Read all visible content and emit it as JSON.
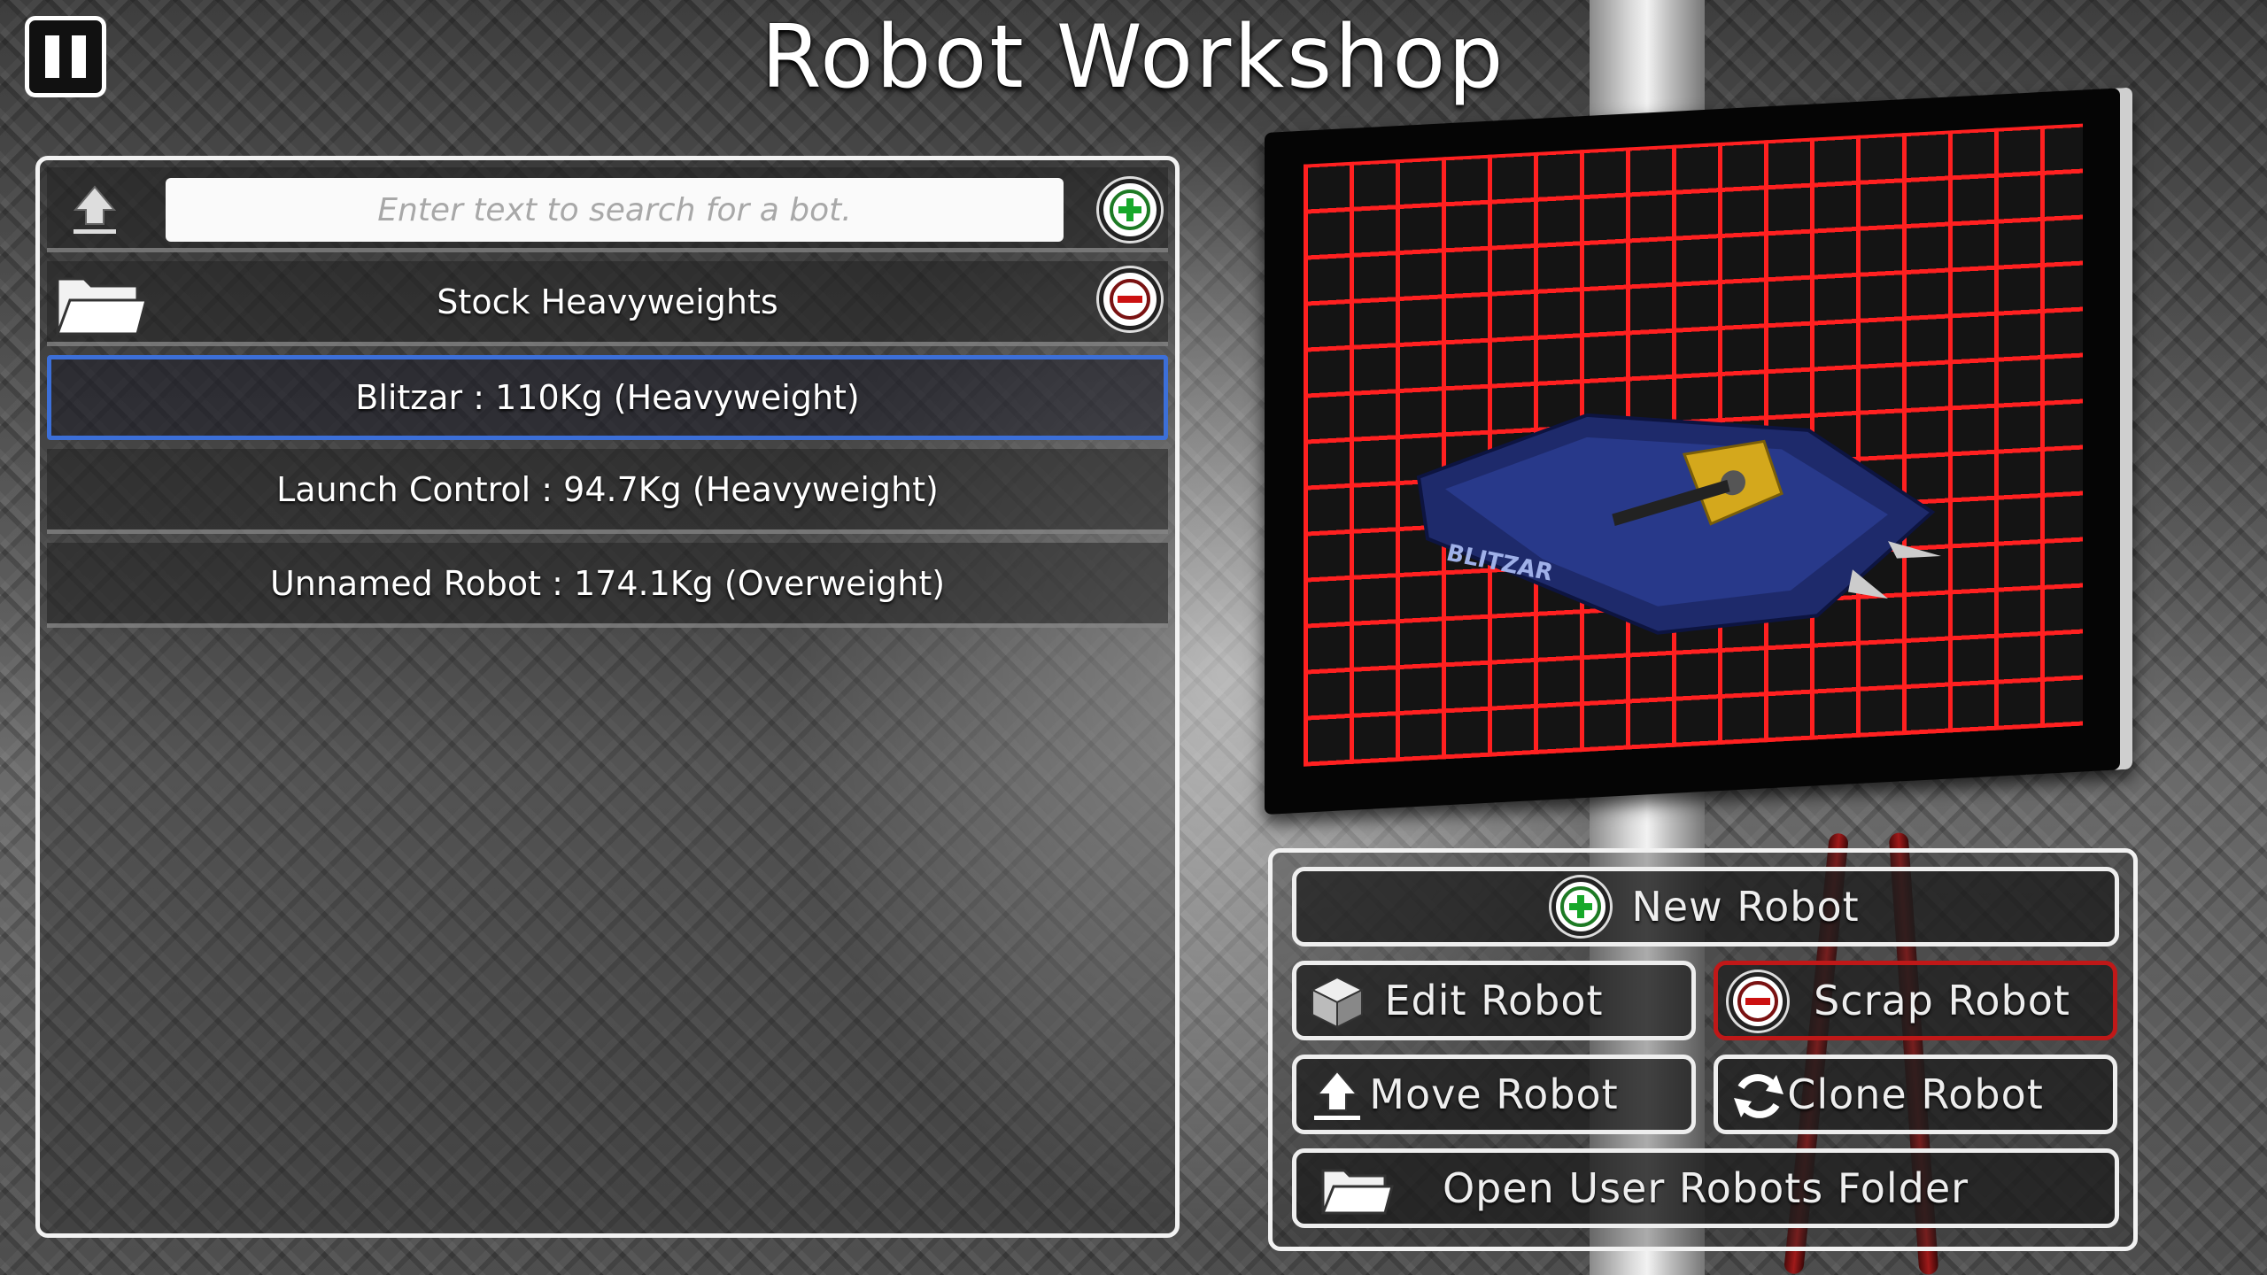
{
  "header": {
    "title": "Robot Workshop"
  },
  "search": {
    "placeholder": "Enter text to search for a bot."
  },
  "folder": {
    "label": "Stock Heavyweights"
  },
  "robots": [
    {
      "label": "Blitzar : 110Kg (Heavyweight)",
      "selected": true
    },
    {
      "label": "Launch Control : 94.7Kg (Heavyweight)",
      "selected": false
    },
    {
      "label": "Unnamed Robot : 174.1Kg (Overweight)",
      "selected": false
    }
  ],
  "preview": {
    "name_plate": "BLITZAR"
  },
  "actions": {
    "new_robot": "New Robot",
    "edit_robot": "Edit Robot",
    "scrap_robot": "Scrap Robot",
    "move_robot": "Move Robot",
    "clone_robot": "Clone Robot",
    "open_folder": "Open User Robots Folder"
  },
  "colors": {
    "selection": "#3c6fd8",
    "danger": "#c01818",
    "grid": "#ff2020",
    "add": "#17a82a"
  }
}
